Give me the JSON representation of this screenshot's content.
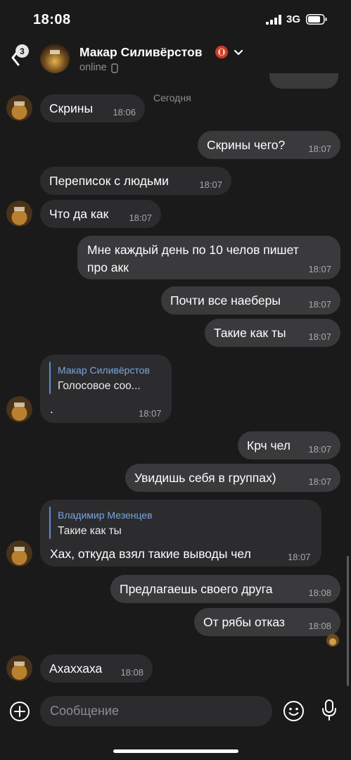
{
  "status_bar": {
    "time": "18:08",
    "network": "3G"
  },
  "header": {
    "back_badge": "3",
    "contact_name": "Макар Силивёрстов",
    "status": "online"
  },
  "date_label": "Сегодня",
  "messages": [
    {
      "side": "in",
      "text": "Скрины",
      "time": "18:06"
    },
    {
      "side": "out",
      "text": "Скрины чего?",
      "time": "18:07"
    },
    {
      "side": "in",
      "text": "Переписок с людьми",
      "time": "18:07"
    },
    {
      "side": "in",
      "text": "Что да как",
      "time": "18:07"
    },
    {
      "side": "out",
      "text_line1": "Мне каждый день по 10 челов пишет",
      "text_line2": "про акк",
      "time": "18:07"
    },
    {
      "side": "out",
      "text": "Почти все наеберы",
      "time": "18:07"
    },
    {
      "side": "out",
      "text": "Такие как ты",
      "time": "18:07"
    },
    {
      "side": "in",
      "reply_name": "Макар Силивёрстов",
      "reply_text": "Голосовое соо...",
      "text": ".",
      "time": "18:07"
    },
    {
      "side": "out",
      "text": "Крч чел",
      "time": "18:07"
    },
    {
      "side": "out",
      "text": "Увидишь себя в группах)",
      "time": "18:07"
    },
    {
      "side": "in",
      "reply_name": "Владимир Мезенцев",
      "reply_text": "Такие как ты",
      "text": "Хах, откуда взял такие выводы чел",
      "time": "18:07"
    },
    {
      "side": "out",
      "text": "Предлагаешь своего друга",
      "time": "18:08"
    },
    {
      "side": "out",
      "text": "От рябы отказ",
      "time": "18:08"
    },
    {
      "side": "in",
      "text": "Ахаххаха",
      "time": "18:08"
    }
  ],
  "input": {
    "placeholder": "Сообщение"
  },
  "icons": {
    "back": "chevron-left-icon",
    "plus": "plus-circle-icon",
    "smile": "emoji-icon",
    "mic": "microphone-icon",
    "phone": "phone-device-icon"
  },
  "colors": {
    "background": "#1a1a1a",
    "incoming_bubble": "#2c2c2e",
    "outgoing_bubble": "#3a3a3c",
    "reply_accent": "#78a5e0"
  }
}
